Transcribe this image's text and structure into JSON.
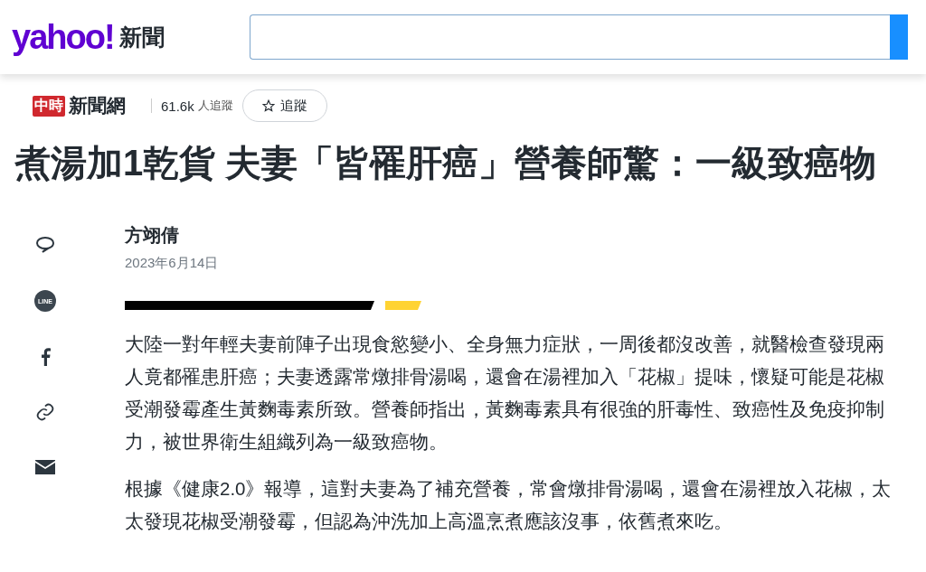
{
  "header": {
    "logo": "yahoo!",
    "section": "新聞"
  },
  "publisher": {
    "badge": "中時",
    "name": "新聞網",
    "followers": "61.6k",
    "followers_label": "人追蹤",
    "follow_button": "追蹤"
  },
  "article": {
    "title": "煮湯加1乾貨 夫妻「皆罹肝癌」營養師驚：一級致癌物",
    "author": "方翊倩",
    "date": "2023年6月14日",
    "paragraphs": [
      "大陸一對年輕夫妻前陣子出現食慾變小、全身無力症狀，一周後都沒改善，就醫檢查發現兩人竟都罹患肝癌；夫妻透露常燉排骨湯喝，還會在湯裡加入「花椒」提味，懷疑可能是花椒受潮發霉產生黃麴毒素所致。營養師指出，黃麴毒素具有很強的肝毒性、致癌性及免疫抑制力，被世界衛生組織列為一級致癌物。",
      "根據《健康2.0》報導，這對夫妻為了補充營養，常會燉排骨湯喝，還會在湯裡放入花椒，太太發現花椒受潮發霉，但認為沖洗加上高溫烹煮應該沒事，依舊煮來吃。"
    ]
  },
  "share": [
    {
      "kind": "comment"
    },
    {
      "kind": "line",
      "label": "LINE"
    },
    {
      "kind": "facebook"
    },
    {
      "kind": "link"
    },
    {
      "kind": "mail"
    }
  ]
}
